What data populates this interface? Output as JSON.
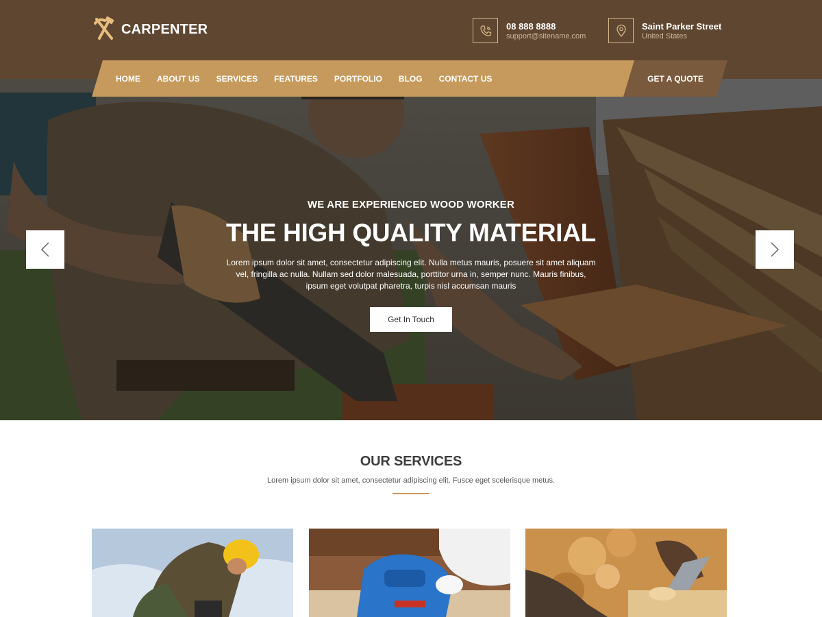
{
  "brand": {
    "name": "CARPENTER",
    "logo_icon": "hammer-pickaxe-icon"
  },
  "contacts": {
    "phone": {
      "icon": "phone-icon",
      "main": "08 888 8888",
      "sub": "support@sitename.com"
    },
    "address": {
      "icon": "location-pin-icon",
      "main": "Saint Parker Street",
      "sub": "United States"
    }
  },
  "nav": {
    "items": [
      {
        "label": "HOME"
      },
      {
        "label": "ABOUT US"
      },
      {
        "label": "SERVICES"
      },
      {
        "label": "FEATURES"
      },
      {
        "label": "PORTFOLIO"
      },
      {
        "label": "BLOG"
      },
      {
        "label": "CONTACT US"
      }
    ],
    "cta": "GET A QUOTE"
  },
  "hero": {
    "kicker": "WE ARE EXPERIENCED WOOD WORKER",
    "title": "THE HIGH QUALITY MATERIAL",
    "text": "Lorem ipsum dolor sit amet, consectetur adipiscing elit. Nulla metus mauris, posuere sit amet aliquam vel, fringilla ac nulla. Nullam sed dolor malesuada, porttitor urna in, semper nunc. Mauris finibus, ipsum eget volutpat pharetra, turpis nisl accumsan mauris",
    "button": "Get In Touch",
    "prev_icon": "chevron-left-icon",
    "next_icon": "chevron-right-icon"
  },
  "services": {
    "title": "OUR SERVICES",
    "subtitle": "Lorem ipsum dolor sit amet, consectetur adipiscing elit. Fusce eget scelerisque metus."
  },
  "colors": {
    "header_bg": "#5f4630",
    "accent": "#c69a5c",
    "quote_bg": "#7a5a3c"
  }
}
